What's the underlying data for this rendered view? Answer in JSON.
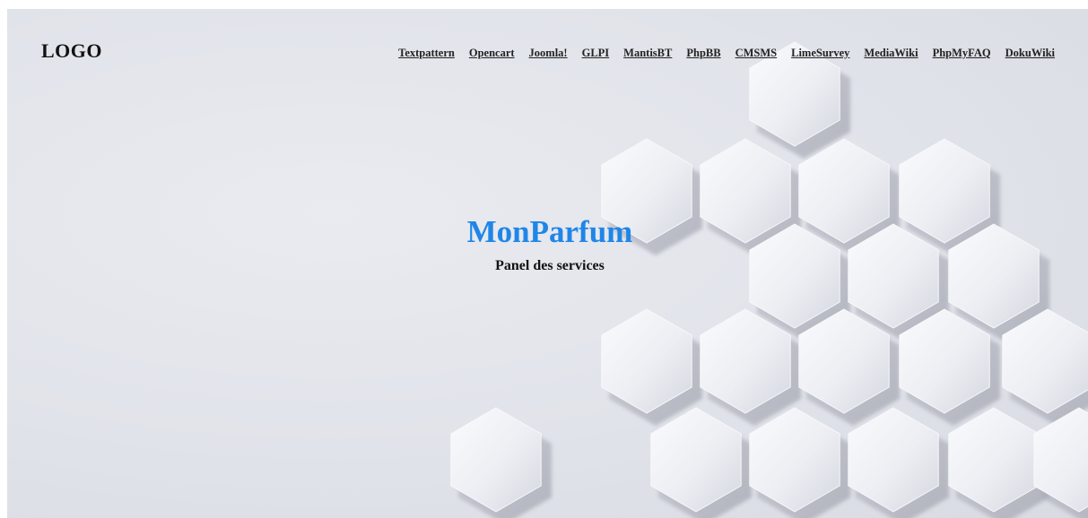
{
  "header": {
    "logo": "LOGO",
    "nav": [
      {
        "label": "Textpattern"
      },
      {
        "label": "Opencart"
      },
      {
        "label": "Joomla!"
      },
      {
        "label": "GLPI"
      },
      {
        "label": "MantisBT"
      },
      {
        "label": "PhpBB"
      },
      {
        "label": "CMSMS"
      },
      {
        "label": "LimeSurvey"
      },
      {
        "label": "MediaWiki"
      },
      {
        "label": "PhpMyFAQ"
      },
      {
        "label": "DokuWiki"
      }
    ]
  },
  "hero": {
    "title": "MonParfum",
    "subtitle": "Panel des services"
  },
  "colors": {
    "title": "#1f86e8",
    "text": "#111111",
    "background": "#e3e5eb"
  }
}
